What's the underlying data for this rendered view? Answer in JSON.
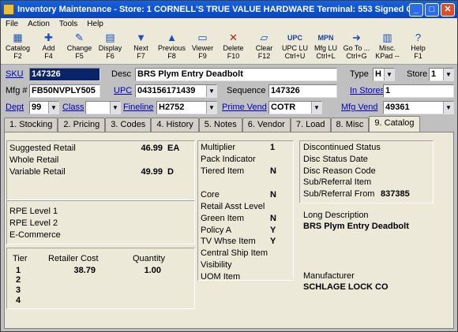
{
  "window": {
    "title": "Inventory Maintenance  -  Store: 1   CORNELL'S TRUE VALUE HARDWARE   Terminal: 553   Signed On User: S..."
  },
  "menu": [
    "File",
    "Action",
    "Tools",
    "Help"
  ],
  "toolbar": [
    {
      "icon": "catalog-icon",
      "glyph": "▦",
      "l1": "Catalog",
      "l2": "F2"
    },
    {
      "icon": "add-icon",
      "glyph": "✚",
      "l1": "Add",
      "l2": "F4"
    },
    {
      "icon": "change-icon",
      "glyph": "✎",
      "l1": "Change",
      "l2": "F5"
    },
    {
      "icon": "display-icon",
      "glyph": "▤",
      "l1": "Display",
      "l2": "F6"
    },
    {
      "icon": "next-icon",
      "glyph": "▼",
      "l1": "Next",
      "l2": "F7"
    },
    {
      "icon": "previous-icon",
      "glyph": "▲",
      "l1": "Previous",
      "l2": "F8"
    },
    {
      "icon": "viewer-icon",
      "glyph": "▭",
      "l1": "Viewer",
      "l2": "F9"
    },
    {
      "icon": "delete-icon",
      "glyph": "✕",
      "l1": "Delete",
      "l2": "F10"
    },
    {
      "icon": "clear-icon",
      "glyph": "▱",
      "l1": "Clear",
      "l2": "F12"
    },
    {
      "icon": "upc-lookup-icon",
      "glyph": "UPC",
      "l1": "UPC LU",
      "l2": "Ctrl+U"
    },
    {
      "icon": "mfg-lookup-icon",
      "glyph": "MPN",
      "l1": "Mfg LU",
      "l2": "Ctrl+L"
    },
    {
      "icon": "goto-icon",
      "glyph": "➜",
      "l1": "Go To ...",
      "l2": "Ctrl+G"
    },
    {
      "icon": "misc-icon",
      "glyph": "▥",
      "l1": "Misc.",
      "l2": "KPad --"
    },
    {
      "icon": "help-icon",
      "glyph": "?",
      "l1": "Help",
      "l2": "F1"
    }
  ],
  "form": {
    "sku_label": "SKU",
    "sku": "147326",
    "desc_label": "Desc",
    "desc": "BRS Plym Entry Deadbolt",
    "type_label": "Type",
    "type": "H",
    "store_label": "Store",
    "store": "1",
    "mfg_label": "Mfg #",
    "mfg": "FB50NVPLY505",
    "upc_label": "UPC",
    "upc": "043156171439",
    "sequence_label": "Sequence",
    "sequence": "147326",
    "in_stores_label": "In Stores",
    "in_stores": "1",
    "dept_label": "Dept",
    "dept": "99",
    "class_label": "Class",
    "class": "",
    "fineline_label": "Fineline",
    "fineline": "H2752",
    "prime_vend_label": "Prime Vend",
    "prime_vend": "COTR",
    "mfg_vend_label": "Mfg Vend",
    "mfg_vend": "49361"
  },
  "tabs": [
    "1. Stocking",
    "2. Pricing",
    "3. Codes",
    "4. History",
    "5. Notes",
    "6. Vendor",
    "7. Load",
    "8. Misc",
    "9. Catalog"
  ],
  "catalog": {
    "suggested_retail_label": "Suggested Retail",
    "suggested_retail": "46.99",
    "suggested_retail_unit": "EA",
    "whole_retail_label": "Whole Retail",
    "variable_retail_label": "Variable Retail",
    "variable_retail": "49.99",
    "variable_retail_code": "D",
    "rpe1_label": "RPE Level 1",
    "rpe2_label": "RPE Level 2",
    "ecommerce_label": "E-Commerce",
    "tier_label": "Tier",
    "retailer_cost_label": "Retailer Cost",
    "quantity_label": "Quantity",
    "tiers": [
      {
        "tier": "1",
        "cost": "38.79",
        "qty": "1.00"
      },
      {
        "tier": "2",
        "cost": "",
        "qty": ""
      },
      {
        "tier": "3",
        "cost": "",
        "qty": ""
      },
      {
        "tier": "4",
        "cost": "",
        "qty": ""
      }
    ],
    "multiplier_label": "Multiplier",
    "multiplier": "1",
    "pack_indicator_label": "Pack Indicator",
    "tiered_item_label": "Tiered Item",
    "tiered_item": "N",
    "core_label": "Core",
    "core": "N",
    "retail_asst_label": "Retail Asst Level",
    "green_item_label": "Green Item",
    "green_item": "N",
    "policy_a_label": "Policy A",
    "policy_a": "Y",
    "tv_whse_label": "TV Whse Item",
    "tv_whse": "Y",
    "central_ship_label": "Central Ship Item",
    "visibility_label": "Visibility",
    "uom_item_label": "UOM Item",
    "discontinued_status_label": "Discontinued Status",
    "disc_status_date_label": "Disc Status Date",
    "disc_reason_label": "Disc Reason Code",
    "sub_ref_item_label": "Sub/Referral Item",
    "sub_ref_from_label": "Sub/Referral From",
    "sub_ref_from": "837385",
    "long_desc_label": "Long Description",
    "long_desc": "BRS Plym Entry Deadbolt",
    "manufacturer_label": "Manufacturer",
    "manufacturer": "SCHLAGE LOCK CO"
  }
}
